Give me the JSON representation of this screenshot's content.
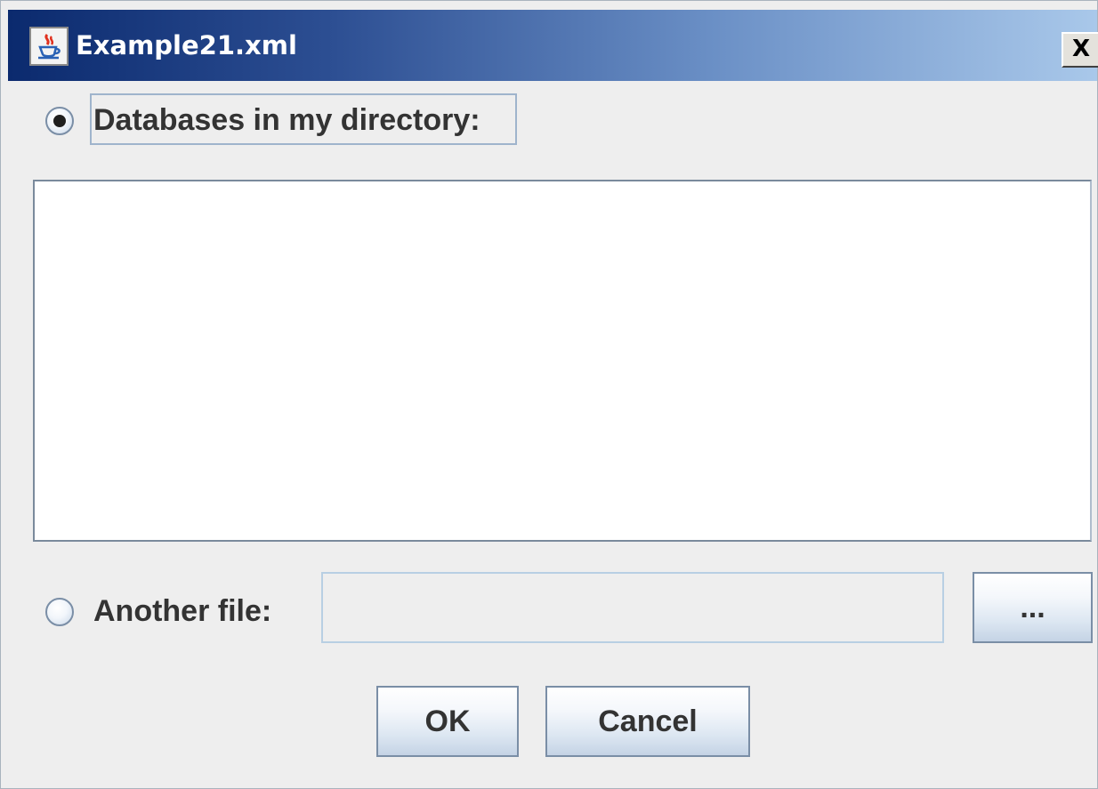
{
  "window": {
    "title": "Example21.xml",
    "close_label": "X"
  },
  "options": {
    "directory": {
      "label": "Databases in my directory:",
      "selected": true
    },
    "another_file": {
      "label": "Another file:",
      "selected": false,
      "path_value": ""
    }
  },
  "database_list": {
    "items": []
  },
  "buttons": {
    "browse_label": "...",
    "ok_label": "OK",
    "cancel_label": "Cancel"
  },
  "icons": {
    "app": "java-cup-icon",
    "close": "close-icon"
  },
  "colors": {
    "title_gradient_start": "#0b2a6e",
    "title_gradient_end": "#a9c8ea",
    "dialog_bg": "#eeeeee",
    "list_bg": "#ffffff",
    "text": "#333333"
  }
}
